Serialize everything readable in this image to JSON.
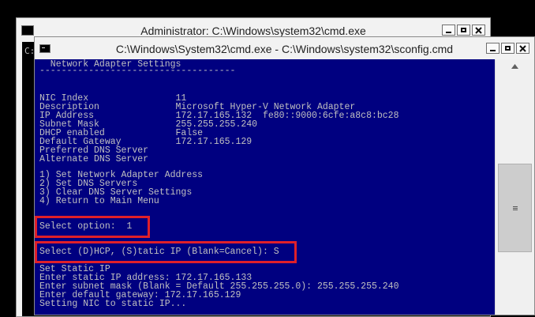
{
  "background_window": {
    "title": "Administrator: C:\\Windows\\system32\\cmd.exe",
    "body_text": "C:"
  },
  "window": {
    "title": "C:\\Windows\\System32\\cmd.exe - C:\\Windows\\system32\\sconfig.cmd",
    "icons": [
      "cmd-icon",
      "minimize-icon",
      "maximize-icon",
      "close-icon"
    ],
    "highlight_color": "#e0202a",
    "console_background": "#000080",
    "console_text_color": "#c0c0c0"
  },
  "console_lines": [
    "  Network Adapter Settings",
    "------------------------------------",
    "",
    "",
    "NIC Index                11",
    "Description              Microsoft Hyper-V Network Adapter",
    "IP Address               172.17.165.132  fe80::9000:6cfe:a8c8:bc28",
    "Subnet Mask              255.255.255.240",
    "DHCP enabled             False",
    "Default Gateway          172.17.165.129",
    "Preferred DNS Server",
    "Alternate DNS Server",
    "",
    "1) Set Network Adapter Address",
    "2) Set DNS Servers",
    "3) Clear DNS Server Settings",
    "4) Return to Main Menu",
    "",
    "",
    "Select option:  1",
    "",
    "",
    "Select (D)HCP, (S)tatic IP (Blank=Cancel): S",
    "",
    "Set Static IP",
    "Enter static IP address: 172.17.165.133",
    "Enter subnet mask (Blank = Default 255.255.255.0): 255.255.255.240",
    "Enter default gateway: 172.17.165.129",
    "Setting NIC to static IP..."
  ]
}
